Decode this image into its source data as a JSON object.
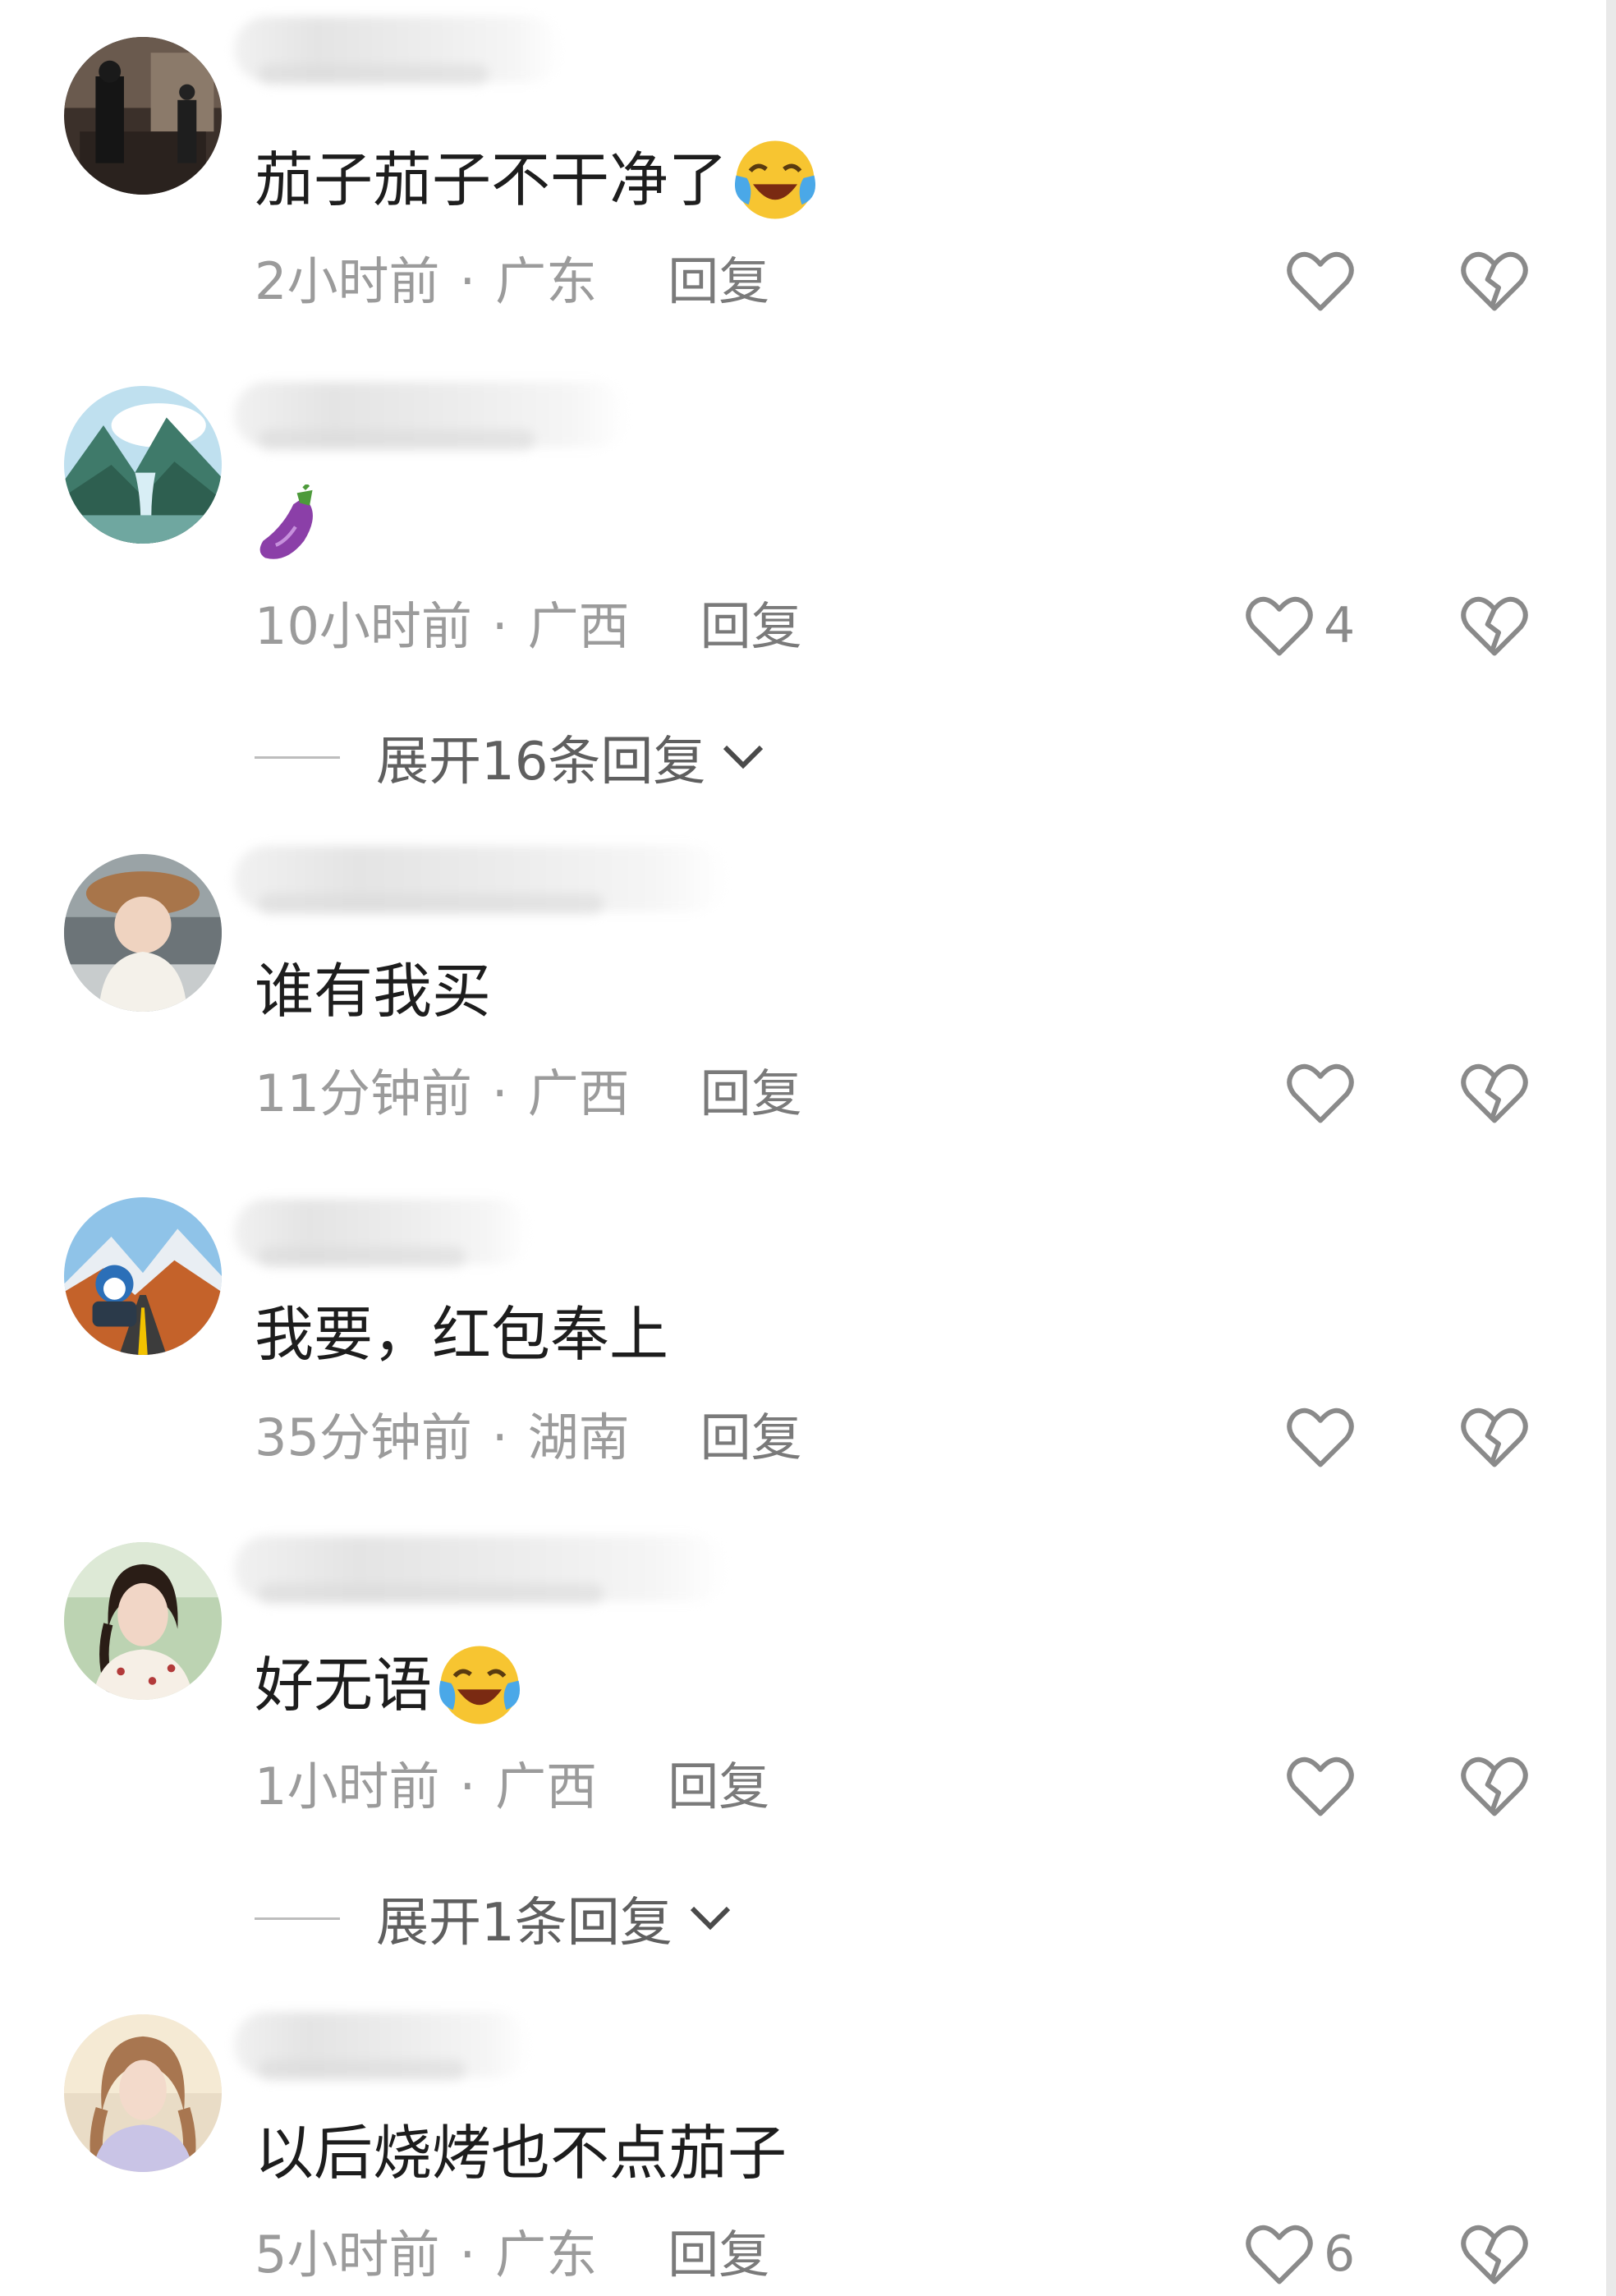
{
  "comments": [
    {
      "text": "茄子茄子不干净了",
      "emoji": "face-with-tears-of-joy-emoji",
      "time": "2小时前",
      "separator": "·",
      "location": "广东",
      "reply_label": "回复",
      "like_count": "",
      "expand_label": ""
    },
    {
      "text": "",
      "emoji": "eggplant-emoji",
      "time": "10小时前",
      "separator": "·",
      "location": "广西",
      "reply_label": "回复",
      "like_count": "4",
      "expand_label": "展开16条回复"
    },
    {
      "text": "谁有我买",
      "emoji": "",
      "time": "11分钟前",
      "separator": "·",
      "location": "广西",
      "reply_label": "回复",
      "like_count": "",
      "expand_label": ""
    },
    {
      "text": "我要，红包奉上",
      "emoji": "",
      "time": "35分钟前",
      "separator": "·",
      "location": "湖南",
      "reply_label": "回复",
      "like_count": "",
      "expand_label": ""
    },
    {
      "text": "好无语",
      "emoji": "face-with-tears-of-joy-emoji",
      "time": "1小时前",
      "separator": "·",
      "location": "广西",
      "reply_label": "回复",
      "like_count": "",
      "expand_label": "展开1条回复"
    },
    {
      "text": "以后烧烤也不点茄子",
      "emoji": "",
      "time": "5小时前",
      "separator": "·",
      "location": "广东",
      "reply_label": "回复",
      "like_count": "6",
      "expand_label": ""
    }
  ],
  "icons": {
    "like": "heart-outline-icon",
    "dislike": "broken-heart-outline-icon",
    "expand": "chevron-down-icon"
  },
  "colors": {
    "text": "#1d1d1d",
    "meta": "#9b9b9b",
    "icon": "#8a8a8a",
    "background": "#ffffff"
  }
}
